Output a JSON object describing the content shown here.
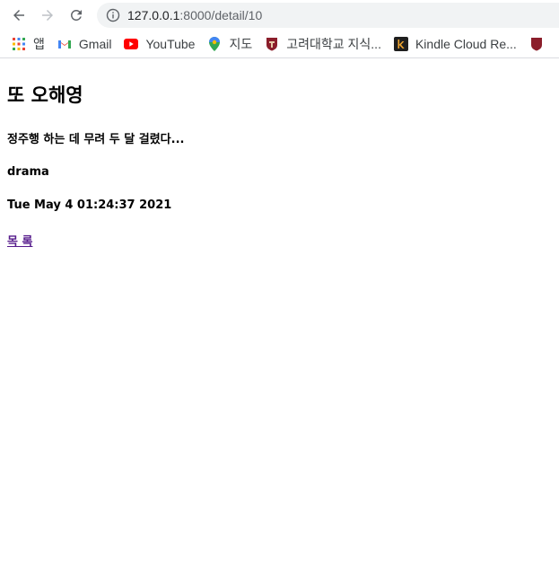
{
  "browser": {
    "url_host": "127.0.0.1",
    "url_path": ":8000/detail/10"
  },
  "bookmarks": [
    {
      "label": "앱",
      "icon": "apps-grid-icon"
    },
    {
      "label": "Gmail",
      "icon": "gmail-icon"
    },
    {
      "label": "YouTube",
      "icon": "youtube-icon"
    },
    {
      "label": "지도",
      "icon": "maps-pin-icon"
    },
    {
      "label": "고려대학교 지식...",
      "icon": "korea-univ-icon"
    },
    {
      "label": "Kindle Cloud Re...",
      "icon": "kindle-icon"
    }
  ],
  "content": {
    "title": "또 오해영",
    "summary": "정주행 하는 데 무려 두 달 걸렸다...",
    "genre": "drama",
    "date": "Tue May 4 01:24:37 2021",
    "back_link": "목 록"
  }
}
